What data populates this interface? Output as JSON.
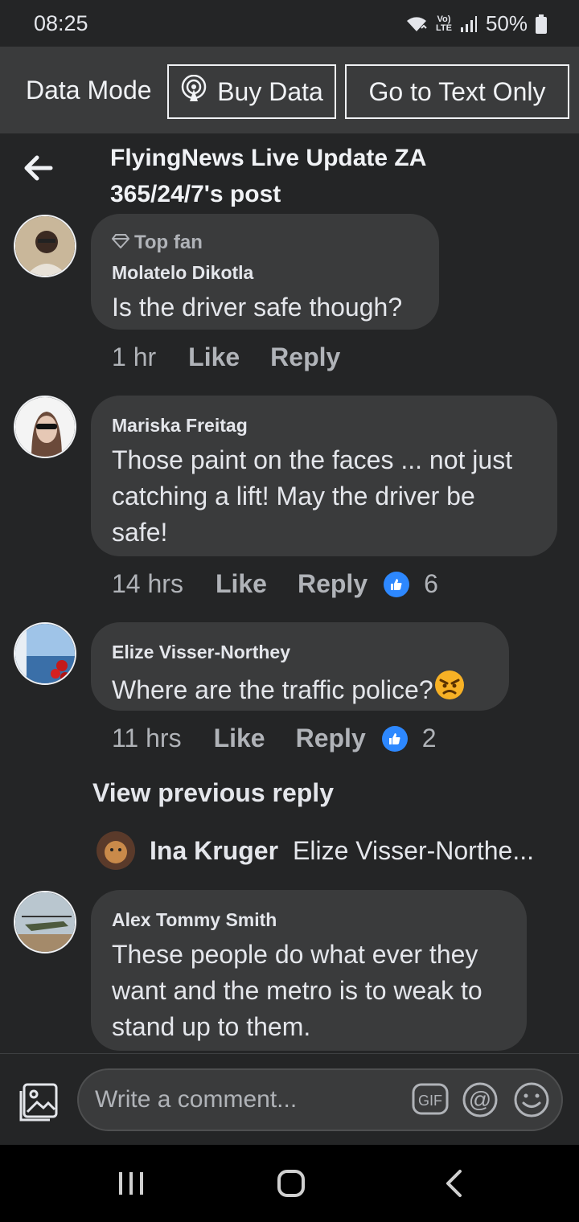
{
  "status": {
    "time": "08:25",
    "network": "LTE",
    "battery": "50%"
  },
  "data_bar": {
    "mode_label": "Data Mode",
    "buy_label": "Buy Data",
    "text_only_label": "Go to Text Only"
  },
  "header": {
    "title": "FlyingNews Live Update ZA 365/24/7's post"
  },
  "comments": [
    {
      "badge": "Top fan",
      "author": "Molatelo Dikotla",
      "text": "Is the driver safe though?",
      "time": "1 hr",
      "like": "Like",
      "reply": "Reply"
    },
    {
      "author": "Mariska Freitag",
      "text": "Those paint on the faces ... not just catching a lift! May the driver be safe!",
      "time": "14 hrs",
      "like": "Like",
      "reply": "Reply",
      "reactions": "6"
    },
    {
      "author": "Elize Visser-Northey",
      "text": "Where are the traffic police?",
      "time": "11 hrs",
      "like": "Like",
      "reply": "Reply",
      "reactions": "2"
    },
    {
      "author": "Alex Tommy Smith",
      "text": "These people do what ever they want and the metro is to weak to stand up to them."
    }
  ],
  "thread": {
    "view_previous": "View previous reply",
    "reply_author": "Ina Kruger",
    "reply_snippet": "Elize Visser-Northe..."
  },
  "composer": {
    "placeholder": "Write a comment..."
  },
  "colors": {
    "background": "#242526",
    "bubble": "#3a3b3c",
    "like_blue": "#2d88ff",
    "data_bar": "#3a3b3c"
  },
  "icons": [
    "wifi-icon",
    "signal-icon",
    "battery-icon",
    "broadcast-icon",
    "back-arrow-icon",
    "diamond-icon",
    "like-reaction-icon",
    "angry-emoji-icon",
    "photo-icon",
    "gif-icon",
    "mention-icon",
    "emoji-icon",
    "nav-recents-icon",
    "nav-home-icon",
    "nav-back-icon"
  ]
}
